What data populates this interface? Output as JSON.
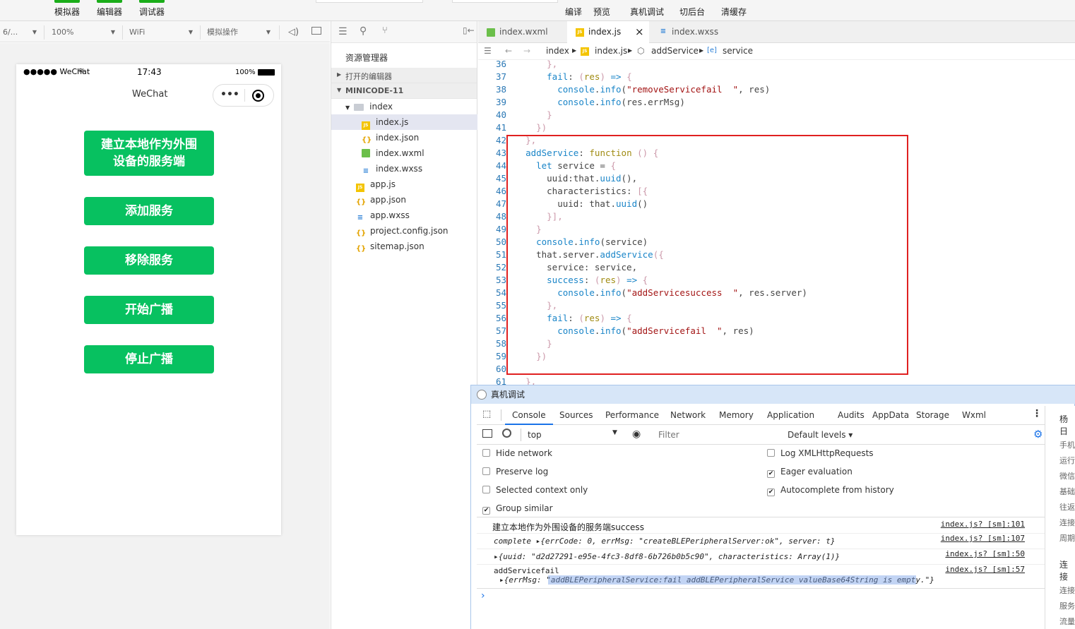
{
  "toolbar": {
    "simulator": "模拟器",
    "editor": "编辑器",
    "debugger": "调试器",
    "compile": "编译",
    "preview": "预览",
    "real_debug": "真机调试",
    "background": "切后台",
    "clear_cache": "清缓存"
  },
  "sim_controls": {
    "device": "6/...",
    "zoom": "100%",
    "network": "WiFi",
    "operation": "模拟操作"
  },
  "phone": {
    "carrier": "●●●●● WeChat",
    "time": "17:43",
    "battery": "100%",
    "nav_title": "WeChat",
    "buttons": [
      "建立本地作为外围\n设备的服务端",
      "添加服务",
      "移除服务",
      "开始广播",
      "停止广播"
    ]
  },
  "explorer": {
    "title": "资源管理器",
    "open_editors": "打开的编辑器",
    "project": "MINICODE-11",
    "folder": "index",
    "files_in_folder": [
      "index.js",
      "index.json",
      "index.wxml",
      "index.wxss"
    ],
    "root_files": [
      "app.js",
      "app.json",
      "app.wxss",
      "project.config.json",
      "sitemap.json"
    ]
  },
  "editor": {
    "tabs": [
      "index.wxml",
      "index.js",
      "index.wxss"
    ],
    "close": "×",
    "breadcrumb": [
      "index",
      "index.js",
      "addService",
      "service"
    ],
    "lines": [
      {
        "n": "36",
        "html": "      <span class=\"br\">},</span>"
      },
      {
        "n": "37",
        "html": "      <span class=\"f\">fail</span>: <span class=\"br\">(</span><span class=\"k\">res</span><span class=\"br\">)</span> <span class=\"f\">=&gt;</span> <span class=\"br\">{</span>"
      },
      {
        "n": "38",
        "html": "        <span class=\"f\">console</span>.<span class=\"f\">info</span>(<span class=\"s\">\"removeServicefail  \"</span>, res)"
      },
      {
        "n": "39",
        "html": "        <span class=\"f\">console</span>.<span class=\"f\">info</span>(res.errMsg)"
      },
      {
        "n": "40",
        "html": "      <span class=\"br\">}</span>"
      },
      {
        "n": "41",
        "html": "    <span class=\"br\">})</span>"
      },
      {
        "n": "42",
        "html": "  <span class=\"br\">},</span>"
      },
      {
        "n": "43",
        "html": "  <span class=\"f\">addService</span>: <span class=\"k\">function</span> <span class=\"br\">()</span> <span class=\"br\">{</span>"
      },
      {
        "n": "44",
        "html": "    <span class=\"f\">let</span> service = <span class=\"br\">{</span>"
      },
      {
        "n": "45",
        "html": "      uuid:that.<span class=\"f\">uuid</span>(),"
      },
      {
        "n": "46",
        "html": "      characteristics: <span class=\"br\">[{</span>"
      },
      {
        "n": "47",
        "html": "        uuid: that.<span class=\"f\">uuid</span>()"
      },
      {
        "n": "48",
        "html": "      <span class=\"br\">}],</span>"
      },
      {
        "n": "49",
        "html": "    <span class=\"br\">}</span>"
      },
      {
        "n": "50",
        "html": "    <span class=\"f\">console</span>.<span class=\"f\">info</span>(service)"
      },
      {
        "n": "51",
        "html": "    that.server.<span class=\"f\">addService</span><span class=\"br\">({</span>"
      },
      {
        "n": "52",
        "html": "      service: service,"
      },
      {
        "n": "53",
        "html": "      <span class=\"f\">success</span>: <span class=\"br\">(</span><span class=\"k\">res</span><span class=\"br\">)</span> <span class=\"f\">=&gt;</span> <span class=\"br\">{</span>"
      },
      {
        "n": "54",
        "html": "        <span class=\"f\">console</span>.<span class=\"f\">info</span>(<span class=\"s\">\"addServicesuccess  \"</span>, res.server)"
      },
      {
        "n": "55",
        "html": "      <span class=\"br\">},</span>"
      },
      {
        "n": "56",
        "html": "      <span class=\"f\">fail</span>: <span class=\"br\">(</span><span class=\"k\">res</span><span class=\"br\">)</span> <span class=\"f\">=&gt;</span> <span class=\"br\">{</span>"
      },
      {
        "n": "57",
        "html": "        <span class=\"f\">console</span>.<span class=\"f\">info</span>(<span class=\"s\">\"addServicefail  \"</span>, res)"
      },
      {
        "n": "58",
        "html": "      <span class=\"br\">}</span>"
      },
      {
        "n": "59",
        "html": "    <span class=\"br\">})</span>"
      },
      {
        "n": "60",
        "html": ""
      },
      {
        "n": "61",
        "html": "  <span class=\"br\">},</span>"
      }
    ]
  },
  "devtools": {
    "title": "真机调试",
    "tabs": [
      "Console",
      "Sources",
      "Performance",
      "Network",
      "Memory",
      "Application",
      "Audits",
      "AppData",
      "Storage",
      "Wxml"
    ],
    "context": "top",
    "filter_placeholder": "Filter",
    "levels": "Default levels ▾",
    "options_left": [
      "Hide network",
      "Preserve log",
      "Selected context only",
      "Group similar"
    ],
    "options_right": [
      "Log XMLHttpRequests",
      "Eager evaluation",
      "Autocomplete from history"
    ],
    "logs": [
      {
        "text": "建立本地作为外围设备的服务端success",
        "src": "index.js? [sm]:101"
      },
      {
        "text": "complete ▸{errCode: 0, errMsg: \"createBLEPeripheralServer:ok\", server: t}",
        "src": "index.js? [sm]:107"
      },
      {
        "text": "▸{uuid: \"d2d27291-e95e-4fc3-8df8-6b726b0b5c90\", characteristics: Array(1)}",
        "src": "index.js? [sm]:50"
      },
      {
        "text": "addServicefail",
        "src": "index.js? [sm]:57"
      },
      {
        "text": "▸{errMsg: \"addBLEPeripheralService:fail addBLEPeripheralService valueBase64String is empty.\"}",
        "src": ""
      }
    ],
    "prompt": "›"
  },
  "right_panel": {
    "items": [
      "杨日",
      "手机",
      "运行",
      "微信",
      "基础",
      "往返",
      "连接",
      "周期",
      "连接",
      "连接",
      "服务",
      "流量"
    ]
  }
}
